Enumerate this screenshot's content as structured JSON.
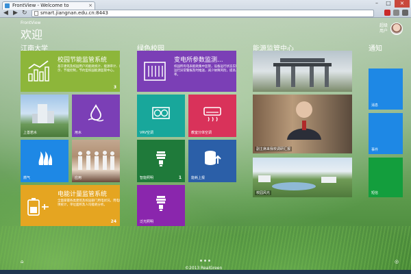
{
  "browser": {
    "tab_title": "FrontView - Welcome to",
    "url": "smart.jiangnan.edu.cn:8443",
    "back_icon": "back-arrow-icon",
    "forward_icon": "forward-arrow-icon",
    "reload_icon": "reload-icon"
  },
  "header": {
    "brand": "FrontView",
    "title": "欢迎",
    "user_name": "超级\n用户"
  },
  "groups": [
    {
      "title": "江南大学"
    },
    {
      "title": "绿色校园"
    },
    {
      "title": "能源监管中心"
    },
    {
      "title": "通知"
    }
  ],
  "tiles": {
    "campus_energy": {
      "title": "校园节能监管系统",
      "desc": "基于建筑及校园用户的能耗统计、能源审计、能效公示、节能控制，节约型校园能源监管中心。",
      "count": "3",
      "color": "#8db63a"
    },
    "power_room": {
      "title": "变电所参数监测...",
      "desc": "校园所有电表能耗集中监管，设备运行状态实时反馈，运行异常警报及时推送，减少故障风险，提高人员效率。",
      "color": "#7b3fb6"
    },
    "campus_photo": {
      "label": "上善若水"
    },
    "water": {
      "label": "用水",
      "color": "#7b3fb6"
    },
    "gas": {
      "label": "燃气",
      "color": "#1e88e5"
    },
    "people_photo": {
      "label": "应用"
    },
    "metering": {
      "title": "电能计量监管系统",
      "desc": "全面掌握各类建筑及校园部门用电状况，用电能耗按分项统计，单位面积及人均能耗分析。",
      "count": "24",
      "color": "#e5a521"
    },
    "vrv_ac": {
      "label": "VRV空调",
      "color": "#18a79b"
    },
    "split_ac": {
      "label": "教室分体空调",
      "color": "#d9325a"
    },
    "smart_light": {
      "label": "智能照明",
      "count": "1",
      "color": "#1f7a3a"
    },
    "upload": {
      "label": "能耗上报",
      "color": "#2b5fa8"
    },
    "street_light": {
      "label": "泛光照明",
      "color": "#8a26ad"
    },
    "gate_photo": {},
    "news_photo": {
      "label": "副主席来我校调研汇报"
    },
    "landscape_photo": {
      "label": "校园风光"
    },
    "notice_1": {
      "label": "消息",
      "color": "#1e88e5"
    },
    "notice_2": {
      "label": "事件",
      "color": "#1e88e5"
    },
    "notice_3": {
      "label": "短信",
      "color": "#139e3d"
    }
  },
  "footer": {
    "copyright": "©2013 RealGreen"
  }
}
